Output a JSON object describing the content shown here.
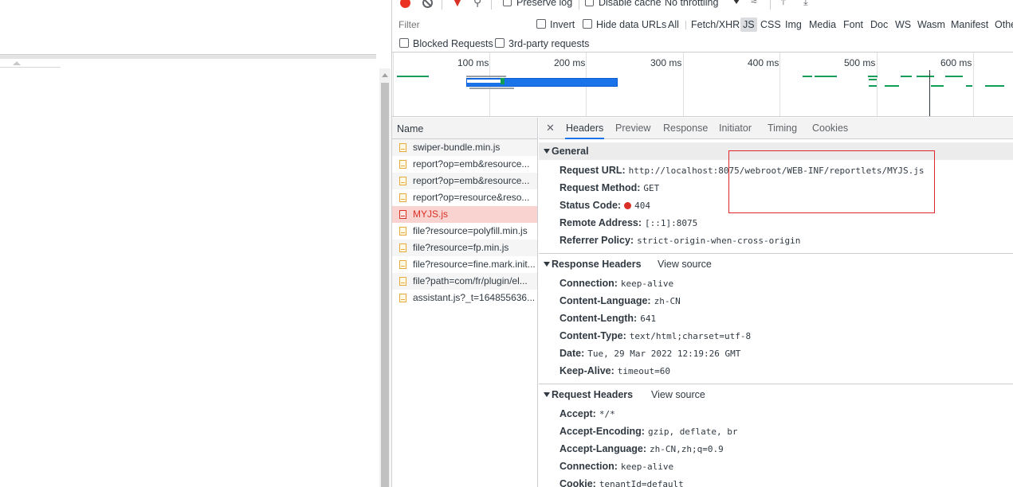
{
  "toolbar": {
    "preserve_log": "Preserve log",
    "disable_cache": "Disable cache",
    "throttling": "No throttling"
  },
  "filter": {
    "placeholder": "Filter",
    "invert": "Invert",
    "hide_data_urls": "Hide data URLs",
    "types": [
      "All",
      "Fetch/XHR",
      "JS",
      "CSS",
      "Img",
      "Media",
      "Font",
      "Doc",
      "WS",
      "Wasm",
      "Manifest",
      "Othe"
    ],
    "active_type": "JS",
    "blocked_requests": "Blocked Requests",
    "third_party": "3rd-party requests"
  },
  "overview": {
    "ticks": [
      "100 ms",
      "200 ms",
      "300 ms",
      "400 ms",
      "500 ms",
      "600 ms"
    ]
  },
  "requests": {
    "header": "Name",
    "items": [
      "swiper-bundle.min.js",
      "report?op=emb&resource...",
      "report?op=emb&resource...",
      "report?op=resource&reso...",
      "MYJS.js",
      "file?resource=polyfill.min.js",
      "file?resource=fp.min.js",
      "file?resource=fine.mark.init...",
      "file?path=com/fr/plugin/el...",
      "assistant.js?_t=164855636..."
    ],
    "selected_index": 4
  },
  "details": {
    "tabs": [
      "Headers",
      "Preview",
      "Response",
      "Initiator",
      "Timing",
      "Cookies"
    ],
    "active_tab": "Headers",
    "general": {
      "title": "General",
      "rows": [
        {
          "k": "Request URL:",
          "v": "http://localhost:8075/webroot/WEB-INF/reportlets/MYJS.js"
        },
        {
          "k": "Request Method:",
          "v": "GET"
        },
        {
          "k": "Status Code:",
          "v": "404"
        },
        {
          "k": "Remote Address:",
          "v": "[::1]:8075"
        },
        {
          "k": "Referrer Policy:",
          "v": "strict-origin-when-cross-origin"
        }
      ]
    },
    "response_headers": {
      "title": "Response Headers",
      "view_source": "View source",
      "rows": [
        {
          "k": "Connection:",
          "v": "keep-alive"
        },
        {
          "k": "Content-Language:",
          "v": "zh-CN"
        },
        {
          "k": "Content-Length:",
          "v": "641"
        },
        {
          "k": "Content-Type:",
          "v": "text/html;charset=utf-8"
        },
        {
          "k": "Date:",
          "v": "Tue, 29 Mar 2022 12:19:26 GMT"
        },
        {
          "k": "Keep-Alive:",
          "v": "timeout=60"
        }
      ]
    },
    "request_headers": {
      "title": "Request Headers",
      "view_source": "View source",
      "rows": [
        {
          "k": "Accept:",
          "v": "*/*"
        },
        {
          "k": "Accept-Encoding:",
          "v": "gzip, deflate, br"
        },
        {
          "k": "Accept-Language:",
          "v": "zh-CN,zh;q=0.9"
        },
        {
          "k": "Connection:",
          "v": "keep-alive"
        },
        {
          "k": "Cookie:",
          "v": "tenantId=default"
        }
      ]
    }
  },
  "colors": {
    "accent": "#1a73e8",
    "error": "#d93025",
    "highlight_box": "#e0262b"
  }
}
